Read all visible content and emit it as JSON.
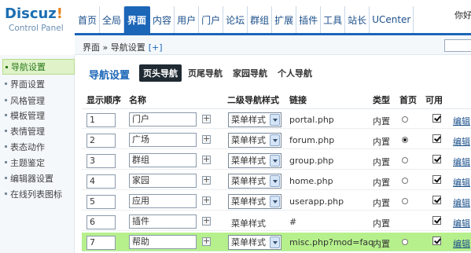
{
  "logo": {
    "brand": "Discuz",
    "bang": "!",
    "sub": "Control Panel"
  },
  "nav": [
    "首页",
    "全局",
    "界面",
    "内容",
    "用户",
    "门户",
    "论坛",
    "群组",
    "扩展",
    "插件",
    "工具",
    "站长",
    "UCenter"
  ],
  "nav_active_index": 2,
  "user_greeting": "你好，",
  "breadcrumb": {
    "path": "界面 » 导航设置",
    "add": "[+]"
  },
  "sidebar": {
    "items": [
      "导航设置",
      "界面设置",
      "风格管理",
      "模板管理",
      "表情管理",
      "表态动作",
      "主题鉴定",
      "编辑器设置",
      "在线列表图标"
    ],
    "active_index": 0
  },
  "main": {
    "title": "导航设置",
    "tabs": [
      "页头导航",
      "页尾导航",
      "家园导航",
      "个人导航"
    ],
    "active_tab": 0,
    "columns": {
      "order": "显示顺序",
      "name": "名称",
      "sub_style": "二级导航样式",
      "link": "链接",
      "type": "类型",
      "home": "首页",
      "enabled": "可用"
    },
    "rows": [
      {
        "order": "1",
        "name": "门户",
        "style": "菜单样式",
        "style_editable": true,
        "link": "portal.php",
        "type": "内置",
        "home": false,
        "enabled": true,
        "edit": "编辑"
      },
      {
        "order": "2",
        "name": "广场",
        "style": "菜单样式",
        "style_editable": true,
        "link": "forum.php",
        "type": "内置",
        "home": true,
        "enabled": true,
        "edit": "编辑"
      },
      {
        "order": "3",
        "name": "群组",
        "style": "菜单样式",
        "style_editable": true,
        "link": "group.php",
        "type": "内置",
        "home": false,
        "enabled": true,
        "edit": "编辑"
      },
      {
        "order": "4",
        "name": "家园",
        "style": "菜单样式",
        "style_editable": true,
        "link": "home.php",
        "type": "内置",
        "home": false,
        "enabled": true,
        "edit": "编辑"
      },
      {
        "order": "5",
        "name": "应用",
        "style": "菜单样式",
        "style_editable": true,
        "link": "userapp.php",
        "type": "内置",
        "home": false,
        "enabled": true,
        "edit": "编辑"
      },
      {
        "order": "6",
        "name": "插件",
        "style": "菜单样式",
        "style_editable": false,
        "link": "#",
        "type": "内置",
        "home": null,
        "enabled": true,
        "edit": "编辑"
      },
      {
        "order": "7",
        "name": "帮助",
        "style": "菜单样式",
        "style_editable": true,
        "link": "misc.php?mod=faq",
        "type": "内置",
        "home": false,
        "enabled": true,
        "edit": "编辑",
        "highlighted": true
      }
    ]
  },
  "colors": {
    "accent": "#1c66b8",
    "highlight": "#b6f08c",
    "sidebar_active": "#dff2c8"
  }
}
